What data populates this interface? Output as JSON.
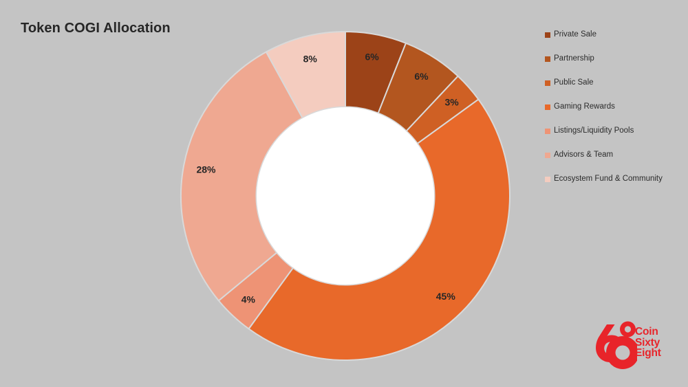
{
  "page": {
    "background_color": "#c4c4c4",
    "title": "Token COGI Allocation"
  },
  "chart_data": {
    "type": "pie",
    "variant": "donut",
    "title": "Token COGI Allocation",
    "xlabel": "",
    "ylabel": "",
    "legend_position": "right",
    "grid": false,
    "label_format": "percent",
    "start_angle_deg": 0,
    "direction": "clockwise",
    "inner_radius_ratio": 0.542,
    "categories": [
      "Private Sale",
      "Partnership",
      "Public Sale",
      "Gaming Rewards",
      "Listings/Liquidity Pools",
      "Advisors & Team",
      "Ecosystem Fund & Community"
    ],
    "values": [
      6,
      6,
      3,
      45,
      4,
      28,
      8
    ],
    "labels": [
      "6%",
      "6%",
      "3%",
      "45%",
      "4%",
      "28%",
      "8%"
    ],
    "colors": [
      "#9c4318",
      "#b3561f",
      "#cf6024",
      "#e8692a",
      "#ee9375",
      "#efa891",
      "#f4ccbf"
    ],
    "slice_border_color": "#d9d9d9",
    "label_color": "#262626",
    "hole_color": "#ffffff"
  },
  "legend": {
    "items": [
      {
        "label": "Private Sale",
        "color": "#9c4318"
      },
      {
        "label": "Partnership",
        "color": "#b3561f"
      },
      {
        "label": "Public Sale",
        "color": "#cf6024"
      },
      {
        "label": "Gaming Rewards",
        "color": "#e8692a"
      },
      {
        "label": "Listings/Liquidity Pools",
        "color": "#ee9375"
      },
      {
        "label": "Advisors & Team",
        "color": "#efa891"
      },
      {
        "label": "Ecosystem Fund & Community",
        "color": "#f4ccbf"
      }
    ]
  },
  "logo": {
    "mark": "68",
    "line1": "Coin",
    "line2": "Sixty",
    "line3": "Eight",
    "color": "#e8242a"
  }
}
